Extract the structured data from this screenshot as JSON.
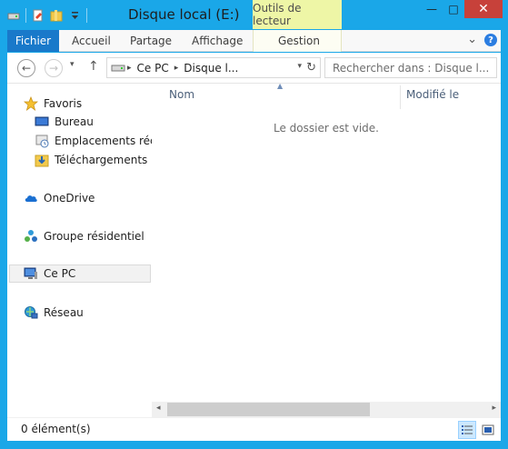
{
  "window": {
    "title": "Disque local (E:)",
    "contextual_tab_group": "Outils de lecteur"
  },
  "quick_access": {
    "icons": [
      "drive-icon",
      "properties-icon",
      "new-folder-icon",
      "customize-dropdown-icon"
    ]
  },
  "window_controls": {
    "minimize": "—",
    "maximize": "□",
    "close": "✕"
  },
  "ribbon": {
    "tabs": [
      {
        "label": "Fichier"
      },
      {
        "label": "Accueil"
      },
      {
        "label": "Partage"
      },
      {
        "label": "Affichage"
      },
      {
        "label": "Gestion"
      }
    ],
    "expand_glyph": "⌄",
    "help_glyph": "?"
  },
  "navigation": {
    "back_glyph": "←",
    "forward_glyph": "→",
    "recent_glyph": "▾",
    "up_glyph": "↑",
    "breadcrumbs": [
      "Ce PC",
      "Disque l..."
    ],
    "chevron": "▸",
    "address_dropdown_glyph": "▾",
    "refresh_glyph": "↻"
  },
  "search": {
    "placeholder": "Rechercher dans : Disque l..."
  },
  "nav_pane": {
    "favorites": {
      "label": "Favoris",
      "items": [
        {
          "label": "Bureau"
        },
        {
          "label": "Emplacements récents"
        },
        {
          "label": "Téléchargements"
        }
      ]
    },
    "onedrive": {
      "label": "OneDrive"
    },
    "homegroup": {
      "label": "Groupe résidentiel"
    },
    "this_pc": {
      "label": "Ce PC"
    },
    "network": {
      "label": "Réseau"
    }
  },
  "file_pane": {
    "columns": [
      {
        "label": "Nom"
      },
      {
        "label": "Modifié le"
      }
    ],
    "sort_glyph": "▲",
    "empty_message": "Le dossier est vide.",
    "scroll_left_glyph": "◂",
    "scroll_right_glyph": "▸"
  },
  "status_bar": {
    "item_count": "0 élément(s)"
  },
  "colors": {
    "window_frame": "#1aa7e8",
    "file_tab": "#1979ca",
    "contextual_tab": "#eef6a6",
    "close_button": "#c7413a",
    "selected_view": "#cce8ff"
  }
}
